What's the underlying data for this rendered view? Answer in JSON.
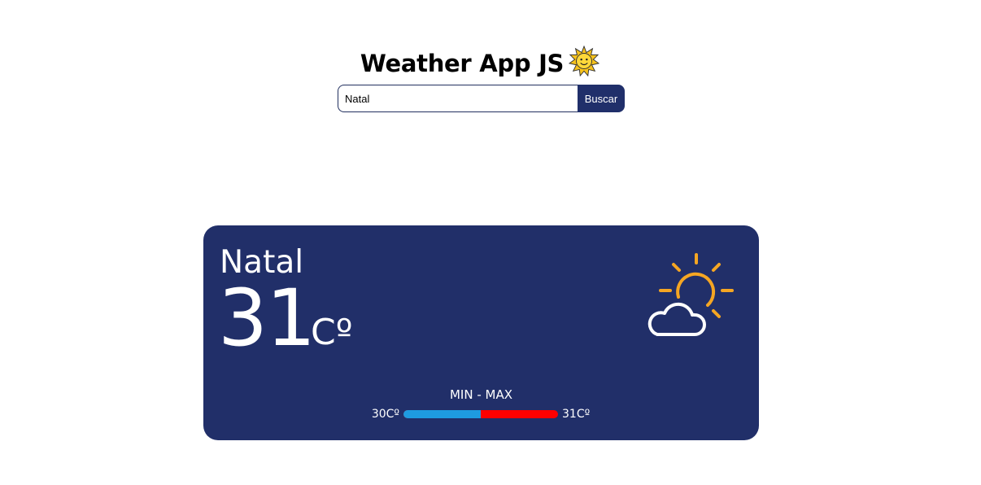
{
  "header": {
    "title": "Weather App JS",
    "title_icon": "sun-with-face-emoji"
  },
  "search": {
    "value": "Natal",
    "button_label": "Buscar"
  },
  "weather": {
    "city": "Natal",
    "temperature": "31",
    "unit": "Cº",
    "condition_icon": "partly-cloudy-icon",
    "minmax_label": "MIN - MAX",
    "min": "30Cº",
    "max": "31Cº",
    "range_split": 0.5
  },
  "colors": {
    "card_background": "#212f69",
    "button_background": "#202f6a",
    "sun": "#f5a623",
    "min_bar": "#1e9be0",
    "max_bar": "#ff0000"
  }
}
